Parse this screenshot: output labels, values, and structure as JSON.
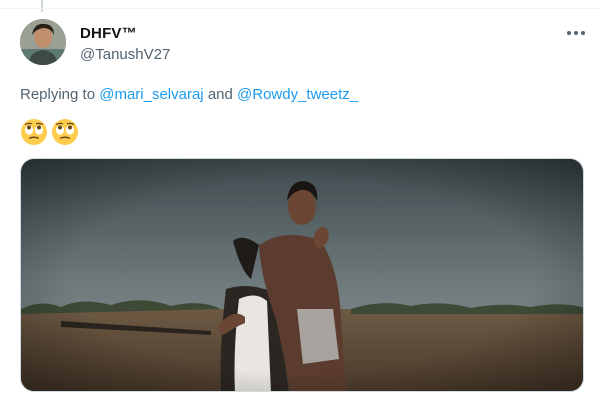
{
  "tweet": {
    "display_name": "DHFV™",
    "handle": "@TanushV27",
    "reply_prefix": "Replying to",
    "reply_mentions": [
      "@mari_selvaraj",
      "@Rowdy_tweetz_"
    ],
    "reply_joiner": "and",
    "emojis": [
      "face-with-rolling-eyes-emoji",
      "face-with-rolling-eyes-emoji"
    ]
  },
  "icons": {
    "more": "more-horizontal-icon"
  },
  "colors": {
    "link": "#1d9bf0",
    "secondary_text": "#536471",
    "primary_text": "#0f1419"
  }
}
